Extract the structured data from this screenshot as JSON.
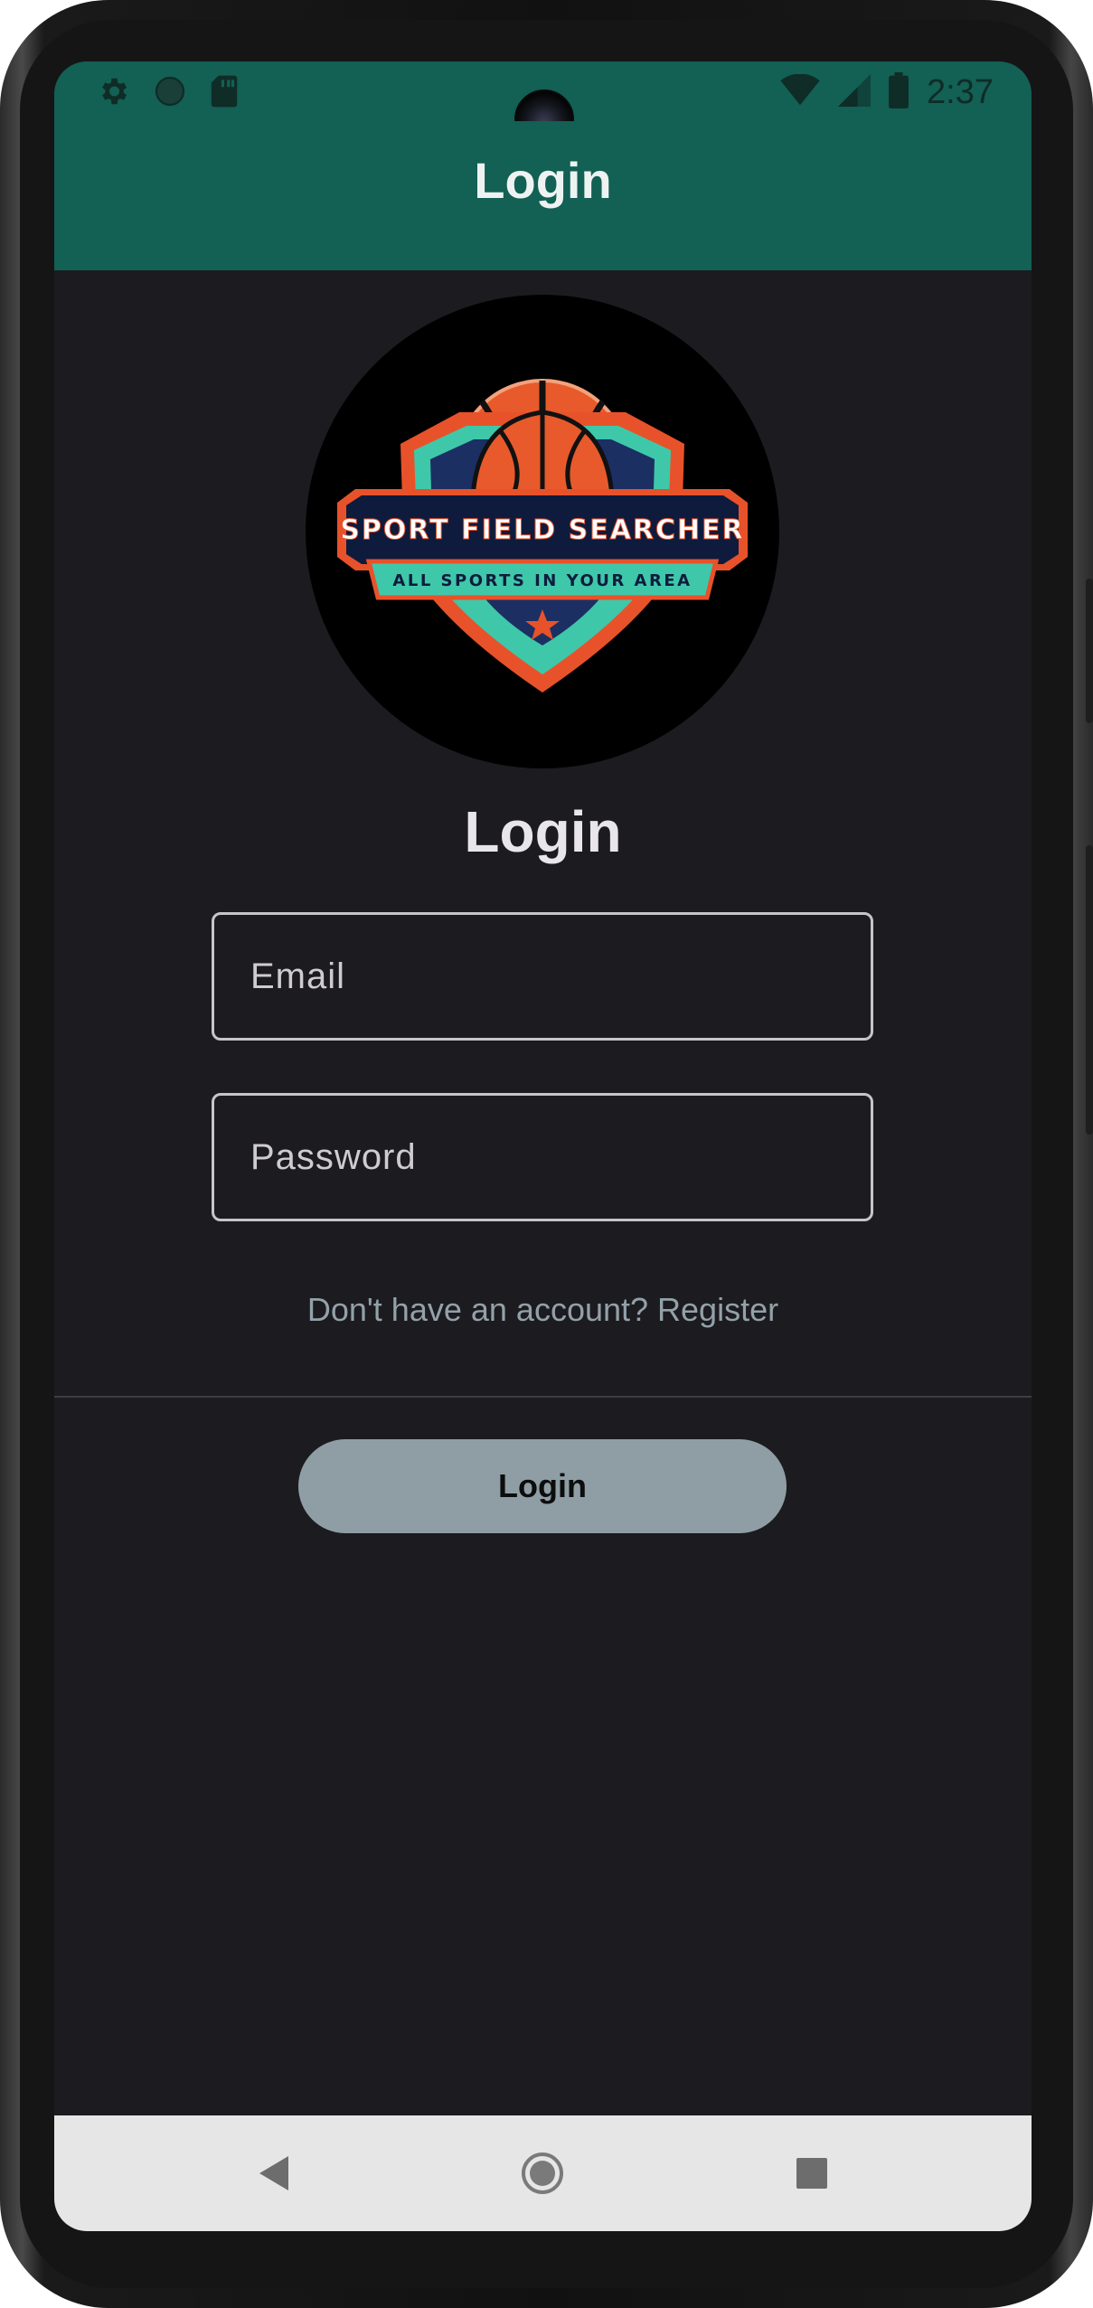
{
  "status_bar": {
    "time": "2:37",
    "left_icons": [
      "gear-icon",
      "circle-icon",
      "sd-card-icon"
    ],
    "right_icons": [
      "wifi-icon",
      "signal-icon",
      "battery-icon"
    ]
  },
  "app_bar": {
    "title": "Login"
  },
  "logo": {
    "title_text": "SPORT FIELD SEARCHER",
    "tagline_text": "ALL SPORTS IN YOUR AREA",
    "colors": {
      "orange": "#e8522a",
      "teal": "#3ec8a9",
      "navy": "#0f1b3d",
      "ball": "#e85a2b"
    }
  },
  "form": {
    "heading": "Login",
    "email_placeholder": "Email",
    "password_placeholder": "Password",
    "register_text": "Don't have an account? Register",
    "submit_label": "Login"
  },
  "nav_bar": {
    "icons": [
      "back-icon",
      "home-icon",
      "recents-icon"
    ]
  },
  "colors": {
    "primary": "#136054",
    "background": "#1c1b1f",
    "button": "#8f9ea5",
    "link": "#93a1a9"
  }
}
